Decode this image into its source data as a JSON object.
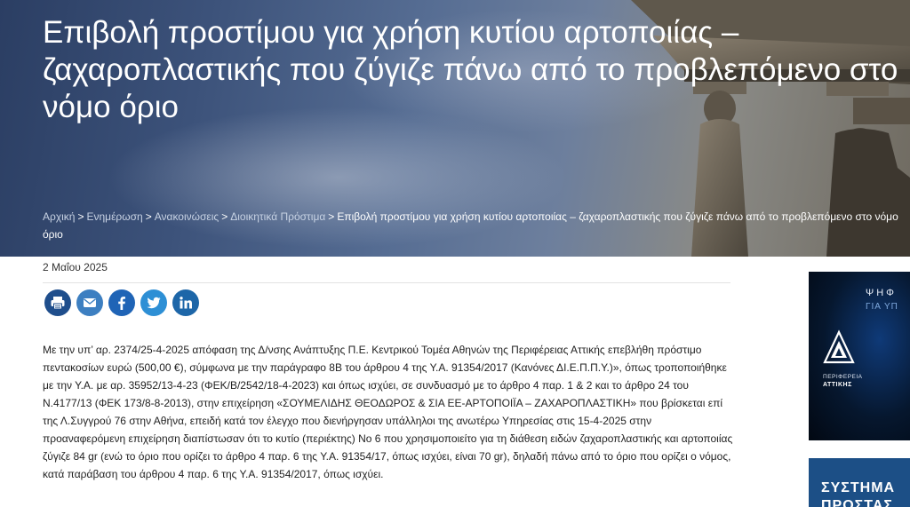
{
  "hero": {
    "title_lines": [
      "Επιβολή προστίμου για χρήση κυτίου αρτοποιίας –",
      "ζαχαροπλαστικής που ζύγιζε πάνω από το προβλεπόμενο στο",
      "νόμο όριο"
    ]
  },
  "breadcrumb": {
    "items": [
      "Αρχική",
      "Ενημέρωση",
      "Ανακοινώσεις",
      "Διοικητικά Πρόστιμα"
    ],
    "separator": ">",
    "current": "Επιβολή προστίμου για χρήση κυτίου αρτοποιίας – ζαχαροπλαστικής που ζύγιζε πάνω από το προβλεπόμενο στο νόμο όριο"
  },
  "post": {
    "date": "2 Μαΐου 2025"
  },
  "share": {
    "buttons": [
      "print",
      "email",
      "facebook",
      "twitter",
      "linkedin"
    ]
  },
  "article": {
    "body": "Με την υπ’ αρ. 2374/25-4-2025  απόφαση της Δ/νσης Ανάπτυξης Π.Ε. Κεντρικού Τομέα Αθηνών της Περιφέρειας Αττικής επεβλήθη πρόστιμο πεντακοσίων  ευρώ  (500,00  €), σύμφωνα με την παράγραφο 8Β του άρθρου 4 της Υ.Α. 91354/2017 (Κανόνες ΔΙ.Ε.Π.Π.Υ.)», όπως τροποποιήθηκε με την Υ.Α. με αρ. 35952/13-4-23 (ΦΕΚ/Β/2542/18-4-2023) και όπως ισχύει,  σε συνδυασμό  με  το  άρθρο  4  παρ. 1 & 2  και  το άρθρο 24 του Ν.4177/13 (ΦΕΚ 173/8-8-2013), στην επιχείρηση  «ΣΟΥΜΕΛΙΔΗΣ ΘΕΟΔΩΡΟΣ & ΣΙΑ ΕΕ-ΑΡΤΟΠΟΙΪΑ – ΖΑΧΑΡΟΠΛΑΣΤΙΚΗ»  που βρίσκεται επί της Λ.Συγγρού 76 στην Αθήνα, επειδή κατά τον έλεγχο που διενήργησαν υπάλληλοι της ανωτέρω Υπηρεσίας στις 15-4-2025 στην προαναφερόμενη επιχείρηση διαπίστωσαν ότι το κυτίο (περιέκτης) Νο 6 που χρησιμοποιείτο για τη διάθεση ειδών ζαχαροπλαστικής και αρτοποιίας ζύγιζε 84 gr (ενώ το όριο που ορίζει το άρθρο 4 παρ. 6 της Υ.Α. 91354/17, όπως ισχύει, είναι 70 gr), δηλαδή πάνω από το όριο που ορίζει ο νόμος, κατά παράβαση του άρθρου 4 παρ. 6  της Υ.Α. 91354/2017, όπως ισχύει."
  },
  "sidebar": {
    "banner1": {
      "line1": "ΨΗΦ",
      "line2": "ΓΙΑ ΥΠ",
      "region_line1": "ΠΕΡΙΦΕΡΕΙΑ",
      "region_line2": "ΑΤΤΙΚΗΣ"
    },
    "banner2": {
      "line1": "ΣΥΣΤΗΜΑ",
      "line2": "ΠΡΟΣΤΑΣ"
    }
  },
  "colors": {
    "hero_overlay": "#3c527a",
    "breadcrumb_link": "#c7d2e3",
    "print_button": "#1f4e8c",
    "email_button": "#3d7fc1",
    "facebook_button": "#1f64b6",
    "twitter_button": "#2d8fd5",
    "linkedin_button": "#1d66a8",
    "banner2_bg": "#1c4f86"
  }
}
